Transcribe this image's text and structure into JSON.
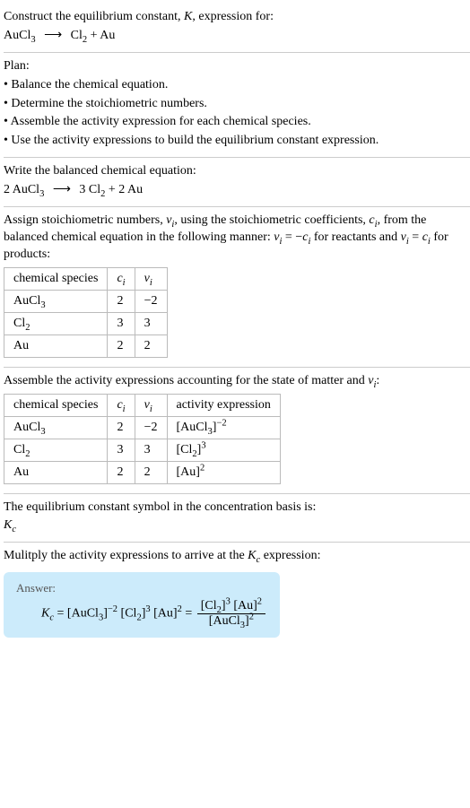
{
  "prompt": {
    "line1": "Construct the equilibrium constant, ",
    "Kname": "K",
    "line1_after": ", expression for:",
    "eqn_lhs": "AuCl",
    "eqn_lhs_sub": "3",
    "eqn_rhs1": "Cl",
    "eqn_rhs1_sub": "2",
    "eqn_plus": " + ",
    "eqn_rhs2": "Au"
  },
  "plan": {
    "title": "Plan:",
    "b1": "• Balance the chemical equation.",
    "b2": "• Determine the stoichiometric numbers.",
    "b3": "• Assemble the activity expression for each chemical species.",
    "b4": "• Use the activity expressions to build the equilibrium constant expression."
  },
  "balance": {
    "intro": "Write the balanced chemical equation:",
    "c_lhs": "2 AuCl",
    "c_lhs_sub": "3",
    "c_rhs1a": "3 Cl",
    "c_rhs1_sub": "2",
    "c_plus": " + ",
    "c_rhs2": "2 Au"
  },
  "stoich": {
    "intro_a": "Assign stoichiometric numbers, ",
    "nu": "ν",
    "i": "i",
    "intro_b": ", using the stoichiometric coefficients, ",
    "c": "c",
    "intro_c": ", from the balanced chemical equation in the following manner: ",
    "rel1a": "ν",
    "rel1b": " = −",
    "rel1c": "c",
    "rel1d": " for reactants and ",
    "rel2a": "ν",
    "rel2b": " = ",
    "rel2c": "c",
    "rel2d": " for products:",
    "hdr_species": "chemical species",
    "hdr_ci": "c",
    "hdr_nui": "ν",
    "rows": [
      {
        "sp": "AuCl",
        "sub": "3",
        "ci": "2",
        "nui": "−2"
      },
      {
        "sp": "Cl",
        "sub": "2",
        "ci": "3",
        "nui": "3"
      },
      {
        "sp": "Au",
        "sub": "",
        "ci": "2",
        "nui": "2"
      }
    ]
  },
  "activity": {
    "intro_a": "Assemble the activity expressions accounting for the state of matter and ",
    "intro_b": ":",
    "hdr_species": "chemical species",
    "hdr_ci": "c",
    "hdr_nui": "ν",
    "hdr_act": "activity expression",
    "rows": [
      {
        "sp": "AuCl",
        "sub": "3",
        "ci": "2",
        "nui": "−2",
        "act_sp": "AuCl",
        "act_sub": "3",
        "act_pow": "−2"
      },
      {
        "sp": "Cl",
        "sub": "2",
        "ci": "3",
        "nui": "3",
        "act_sp": "Cl",
        "act_sub": "2",
        "act_pow": "3"
      },
      {
        "sp": "Au",
        "sub": "",
        "ci": "2",
        "nui": "2",
        "act_sp": "Au",
        "act_sub": "",
        "act_pow": "2"
      }
    ]
  },
  "ksymbol": {
    "intro": "The equilibrium constant symbol in the concentration basis is:",
    "K": "K",
    "sub": "c"
  },
  "multiply": {
    "intro_a": "Mulitply the activity expressions to arrive at the ",
    "Kc_K": "K",
    "Kc_sub": "c",
    "intro_b": " expression:"
  },
  "answer": {
    "label": "Answer:",
    "Kc_K": "K",
    "Kc_sub": "c",
    "eq": " = ",
    "t1_sp": "AuCl",
    "t1_sub": "3",
    "t1_pow": "−2",
    "t2_sp": "Cl",
    "t2_sub": "2",
    "t2_pow": "3",
    "t3_sp": "Au",
    "t3_sub": "",
    "t3_pow": "2",
    "eq2": " = ",
    "num1_sp": "Cl",
    "num1_sub": "2",
    "num1_pow": "3",
    "num2_sp": "Au",
    "num2_sub": "",
    "num2_pow": "2",
    "den_sp": "AuCl",
    "den_sub": "3",
    "den_pow": "2"
  }
}
